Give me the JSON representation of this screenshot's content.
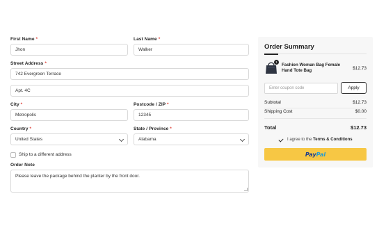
{
  "form": {
    "first_name": {
      "label": "First Name",
      "value": "Jhon"
    },
    "last_name": {
      "label": "Last Name",
      "value": "Walker"
    },
    "street": {
      "label": "Street Address",
      "value": "742 Evergreen Terrace",
      "value2": "Apt. 4C"
    },
    "city": {
      "label": "City",
      "value": "Metropolis"
    },
    "postcode": {
      "label": "Postcode / ZIP",
      "value": "12345"
    },
    "country": {
      "label": "Country",
      "value": "United States"
    },
    "state": {
      "label": "State / Province",
      "value": "Alabama"
    },
    "required_mark": "*",
    "ship_different": {
      "label": "Ship to a different address",
      "checked": false
    },
    "order_note": {
      "label": "Order Note",
      "value": "Please leave the package behind the planter by the front door."
    }
  },
  "summary": {
    "title": "Order Summary",
    "product": {
      "name": "Fashion Woman Bag Female Hand Tote Bag",
      "price": "$12.73",
      "qty": "1",
      "image_icon": "handbag-icon"
    },
    "coupon_placeholder": "Enter coupon code",
    "apply_label": "Apply",
    "subtotal_label": "Subtotal",
    "subtotal_value": "$12.73",
    "shipping_label": "Shipping Cost",
    "shipping_value": "$0.00",
    "total_label": "Total",
    "total_value": "$12.73",
    "agree_prefix": "I agree to the",
    "agree_link": "Terms & Conditions",
    "agree_checked": true,
    "paypal_part1": "Pay",
    "paypal_part2": "Pal",
    "paypal_color": "#f7c744"
  }
}
